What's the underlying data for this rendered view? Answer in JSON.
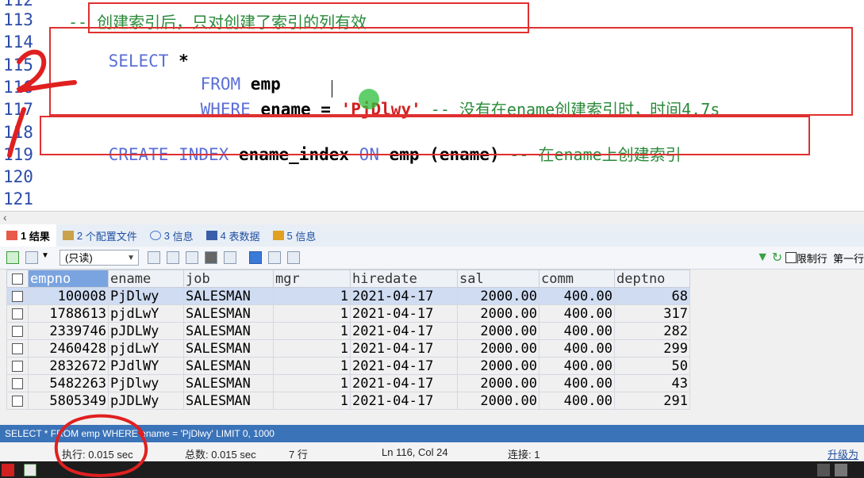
{
  "editor": {
    "line_numbers": [
      "112",
      "113",
      "114",
      "115",
      "116",
      "117",
      "118",
      "119",
      "120",
      "121"
    ],
    "lines": {
      "l113": "-- 创建索引后，只对创建了索引的列有效",
      "l114_kw": "SELECT",
      "l114_rest": " *",
      "l115_kw": "FROM",
      "l115_rest": " emp",
      "l116_kw": "WHERE",
      "l116_mid": " ename = ",
      "l116_str": "'PjDlwy'",
      "l116_cm": " -- 没有在ename创建索引时，时间4.7s",
      "l118_kw1": "CREATE INDEX",
      "l118_mid1": " ename_index ",
      "l118_kw2": "ON",
      "l118_mid2": " emp (ename) ",
      "l118_cm": "-- 在ename上创建索引"
    }
  },
  "tabs": [
    {
      "num": "1",
      "label": "结果"
    },
    {
      "num": "2",
      "label": "个配置文件"
    },
    {
      "num": "3",
      "label": "信息"
    },
    {
      "num": "4",
      "label": "表数据"
    },
    {
      "num": "5",
      "label": "信息"
    }
  ],
  "toolbar": {
    "mode_select": "(只读)",
    "limit_label": "限制行",
    "first_row_label": "第一行"
  },
  "grid": {
    "columns": [
      "empno",
      "ename",
      "job",
      "mgr",
      "hiredate",
      "sal",
      "comm",
      "deptno"
    ],
    "rows": [
      [
        "100008",
        "PjDlwy",
        "SALESMAN",
        "1",
        "2021-04-17",
        "2000.00",
        "400.00",
        "68"
      ],
      [
        "1788613",
        "pjdLwY",
        "SALESMAN",
        "1",
        "2021-04-17",
        "2000.00",
        "400.00",
        "317"
      ],
      [
        "2339746",
        "pJDLWy",
        "SALESMAN",
        "1",
        "2021-04-17",
        "2000.00",
        "400.00",
        "282"
      ],
      [
        "2460428",
        "pjdLwY",
        "SALESMAN",
        "1",
        "2021-04-17",
        "2000.00",
        "400.00",
        "299"
      ],
      [
        "2832672",
        "PJdlWY",
        "SALESMAN",
        "1",
        "2021-04-17",
        "2000.00",
        "400.00",
        "50"
      ],
      [
        "5482263",
        "PjDlwy",
        "SALESMAN",
        "1",
        "2021-04-17",
        "2000.00",
        "400.00",
        "43"
      ],
      [
        "5805349",
        "pJDLWy",
        "SALESMAN",
        "1",
        "2021-04-17",
        "2000.00",
        "400.00",
        "291"
      ]
    ]
  },
  "sql_bar": "SELECT * FROM emp WHERE ename = 'PjDlwy' LIMIT 0, 1000",
  "status": {
    "exec": "执行: 0.015 sec",
    "total": "总数: 0.015 sec",
    "rows": "7 行",
    "position": "Ln 116, Col 24",
    "connection": "连接: 1",
    "upgrade": "升级为"
  },
  "colors": {
    "keyword": "#5b6fd6",
    "string": "#d22020",
    "comment": "#2a8a3a",
    "annotation": "#e02020",
    "sql_bar": "#3b73b9"
  }
}
